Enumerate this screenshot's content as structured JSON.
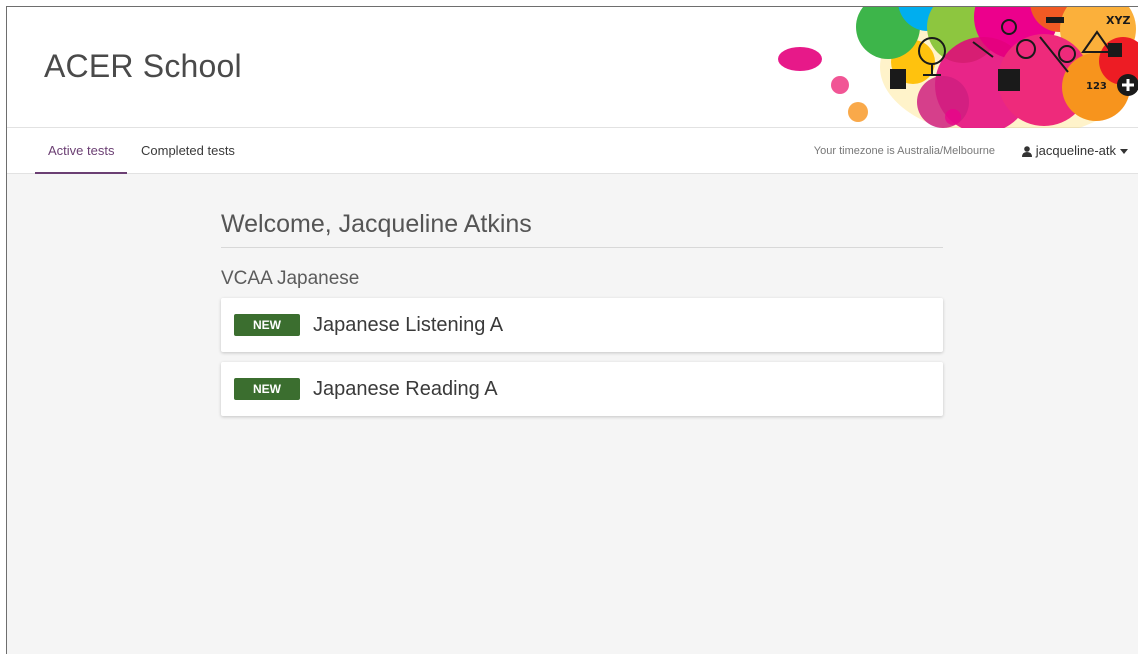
{
  "header": {
    "brand": "ACER School"
  },
  "nav": {
    "tabs": [
      {
        "label": "Active tests",
        "active": true
      },
      {
        "label": "Completed tests",
        "active": false
      }
    ],
    "timezone_text": "Your timezone is Australia/Melbourne",
    "user_name": "jacqueline-atk"
  },
  "main": {
    "welcome": "Welcome, Jacqueline Atkins",
    "groups": [
      {
        "title": "VCAA Japanese",
        "tests": [
          {
            "badge": "NEW",
            "name": "Japanese Listening A"
          },
          {
            "badge": "NEW",
            "name": "Japanese Reading A"
          }
        ]
      }
    ]
  },
  "colors": {
    "accent": "#6b3f73",
    "badge": "#3b6e2f"
  },
  "icons": {
    "user": "user-icon",
    "caret": "caret-down-icon"
  }
}
